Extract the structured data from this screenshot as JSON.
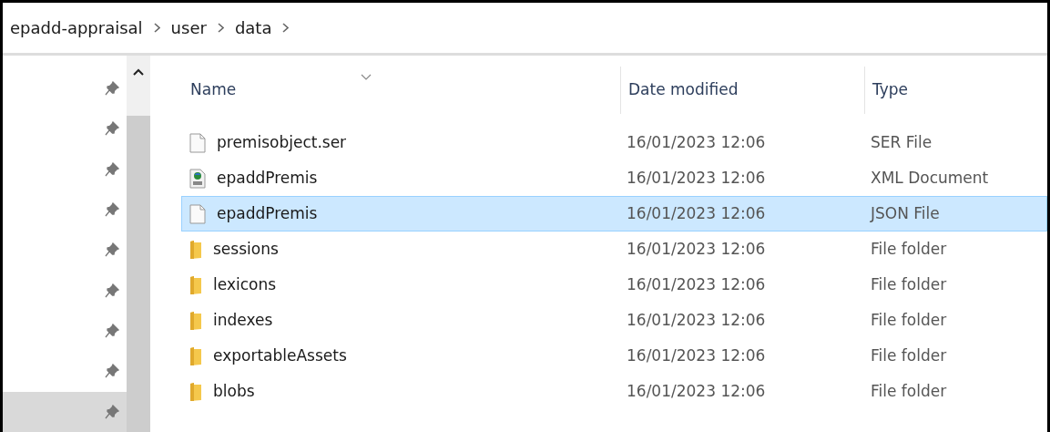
{
  "breadcrumb": [
    "epadd-appraisal",
    "user",
    "data"
  ],
  "nav_pane": {
    "items": [
      {
        "selected": false
      },
      {
        "selected": false
      },
      {
        "selected": false
      },
      {
        "selected": false
      },
      {
        "selected": false
      },
      {
        "selected": false
      },
      {
        "selected": false
      },
      {
        "selected": false
      },
      {
        "selected": true
      }
    ]
  },
  "table": {
    "columns": [
      "Name",
      "Date modified",
      "Type"
    ],
    "rows": [
      {
        "kind": "file",
        "name": "premisobject.ser",
        "date": "16/01/2023 12:06",
        "type": "SER File",
        "selected": false
      },
      {
        "kind": "xml",
        "name": "epaddPremis",
        "date": "16/01/2023 12:06",
        "type": "XML Document",
        "selected": false
      },
      {
        "kind": "file",
        "name": "epaddPremis",
        "date": "16/01/2023 12:06",
        "type": "JSON File",
        "selected": true
      },
      {
        "kind": "folder",
        "name": "sessions",
        "date": "16/01/2023 12:06",
        "type": "File folder",
        "selected": false
      },
      {
        "kind": "folder",
        "name": "lexicons",
        "date": "16/01/2023 12:06",
        "type": "File folder",
        "selected": false
      },
      {
        "kind": "folder",
        "name": "indexes",
        "date": "16/01/2023 12:06",
        "type": "File folder",
        "selected": false
      },
      {
        "kind": "folder",
        "name": "exportableAssets",
        "date": "16/01/2023 12:06",
        "type": "File folder",
        "selected": false
      },
      {
        "kind": "folder",
        "name": "blobs",
        "date": "16/01/2023 12:06",
        "type": "File folder",
        "selected": false
      }
    ]
  }
}
